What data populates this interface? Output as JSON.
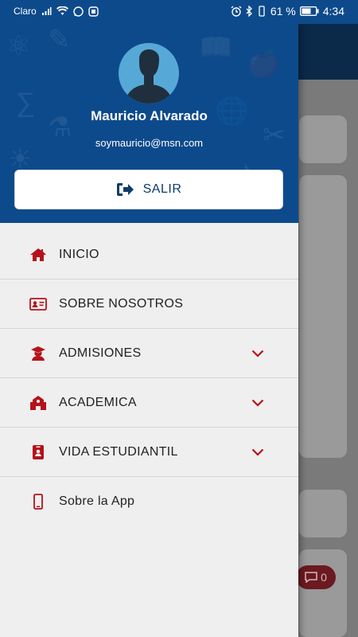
{
  "status_bar": {
    "carrier": "Claro",
    "battery": "61 %",
    "time": "4:34"
  },
  "drawer": {
    "user_name": "Mauricio Alvarado",
    "user_email": "soymauricio@msn.com",
    "logout_label": "SALIR",
    "menu": [
      {
        "label": "INICIO",
        "icon": "home-icon",
        "expandable": false
      },
      {
        "label": "SOBRE NOSOTROS",
        "icon": "id-card-icon",
        "expandable": false
      },
      {
        "label": "ADMISIONES",
        "icon": "graduate-icon",
        "expandable": true
      },
      {
        "label": "ACADEMICA",
        "icon": "school-icon",
        "expandable": true
      },
      {
        "label": "VIDA ESTUDIANTIL",
        "icon": "badge-icon",
        "expandable": true
      },
      {
        "label": "Sobre la App",
        "icon": "mobile-phone-icon",
        "expandable": false
      }
    ]
  },
  "background": {
    "comments_count": "0"
  },
  "colors": {
    "header_blue": "#0d4a8c",
    "accent_red": "#b5121b",
    "drawer_bg": "#efefef"
  }
}
